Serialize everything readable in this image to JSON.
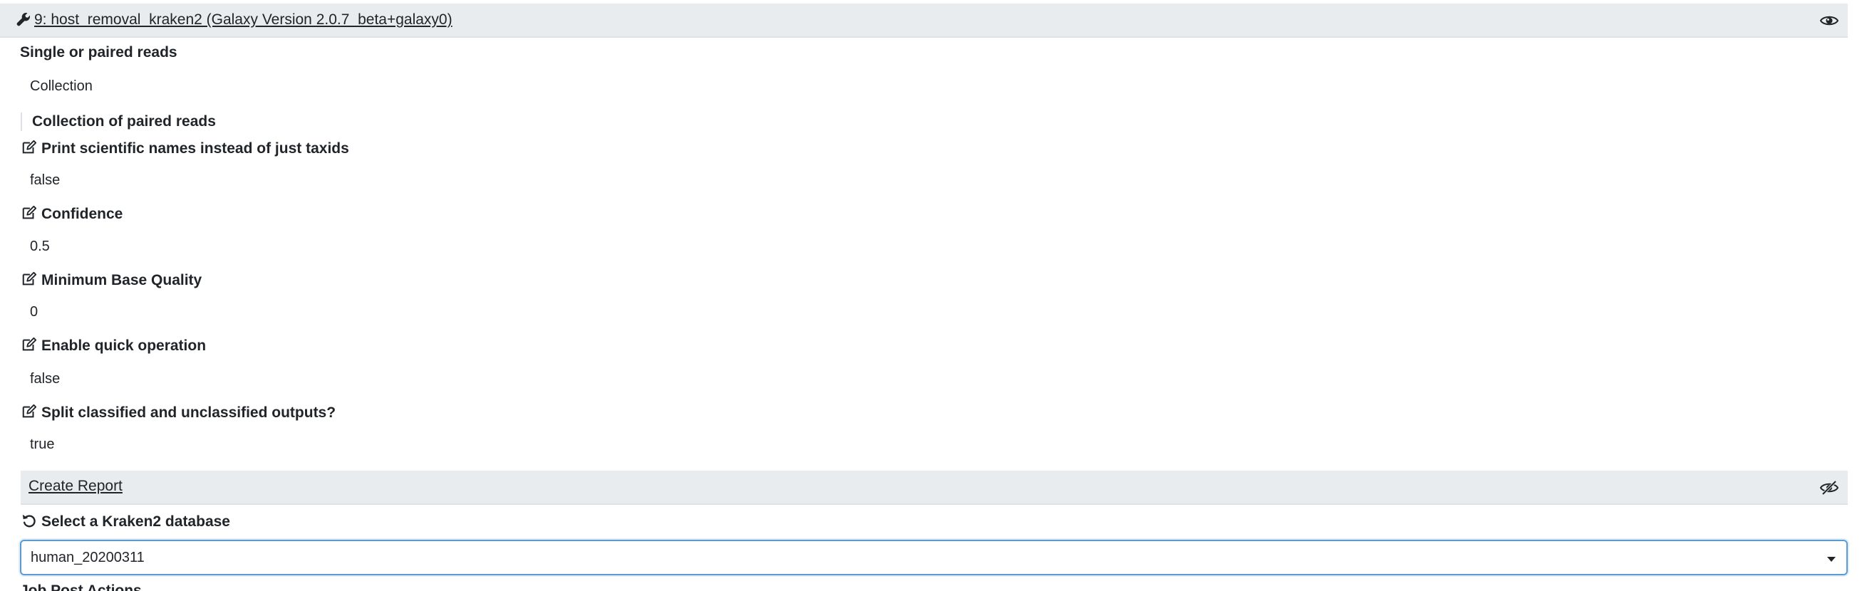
{
  "step": {
    "title": "9: host_removal_kraken2 (Galaxy Version 2.0.7_beta+galaxy0)"
  },
  "params": [
    {
      "label": "Single or paired reads",
      "value": "Collection",
      "editable": false
    },
    {
      "label": "Print scientific names instead of just taxids",
      "value": "false",
      "editable": true
    },
    {
      "label": "Confidence",
      "value": "0.5",
      "editable": true
    },
    {
      "label": "Minimum Base Quality",
      "value": "0",
      "editable": true
    },
    {
      "label": "Enable quick operation",
      "value": "false",
      "editable": true
    },
    {
      "label": "Split classified and unclassified outputs?",
      "value": "true",
      "editable": true
    }
  ],
  "subsection_label": "Collection of paired reads",
  "report_section": {
    "title": "Create Report"
  },
  "database": {
    "label": "Select a Kraken2 database",
    "selected": "human_20200311"
  },
  "next_section_label": "Job Post Actions",
  "icons": {
    "header": "wrench-icon",
    "visibility": "eye-icon",
    "edit": "edit-icon",
    "report_visibility": "eye-slash-icon",
    "database": "undo-icon",
    "select": "caret-down-icon"
  },
  "colors": {
    "header_bg": "#e9ecef",
    "text": "#212529",
    "focus_border": "#5b9bd5"
  }
}
